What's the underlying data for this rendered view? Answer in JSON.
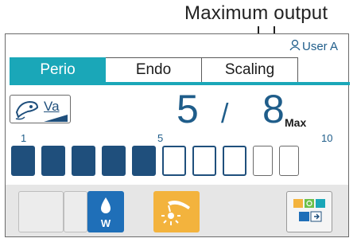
{
  "annotation": {
    "title": "Maximum output"
  },
  "user": {
    "label": "User A"
  },
  "tabs": [
    {
      "label": "Perio",
      "active": true
    },
    {
      "label": "Endo",
      "active": false
    },
    {
      "label": "Scaling",
      "active": false
    }
  ],
  "mode": {
    "label": "Va",
    "icon": "handpiece-icon"
  },
  "output": {
    "current": "5",
    "slash": "/",
    "max": "8",
    "max_label": "Max"
  },
  "scale": {
    "start": "1",
    "mid": "5",
    "end": "10"
  },
  "bars": {
    "level": 5,
    "total": 10
  },
  "bottom": {
    "water_label": "W",
    "water_icon": "water-drop-icon",
    "light_icon": "tip-light-icon",
    "settings_icon": "settings-grid-icon"
  },
  "colors": {
    "accent": "#1aa7b8",
    "dark_blue": "#1f4f7c",
    "water": "#1f6fb8",
    "light": "#f3b33d"
  }
}
